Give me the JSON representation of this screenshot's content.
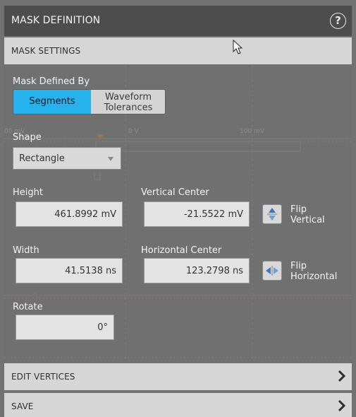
{
  "header": {
    "title": "MASK DEFINITION",
    "help_icon": "?"
  },
  "mask_settings": {
    "section_label": "MASK SETTINGS",
    "mask_defined_by": {
      "label": "Mask Defined By",
      "options": [
        "Segments",
        "Waveform Tolerances"
      ],
      "option_line1": "Waveform",
      "option_line2": "Tolerances",
      "selected": "Segments"
    },
    "shape": {
      "label": "Shape",
      "value": "Rectangle"
    },
    "height": {
      "label": "Height",
      "value": "461.8992 mV"
    },
    "vertical_center": {
      "label": "Vertical Center",
      "value": "-21.5522 mV"
    },
    "flip_vertical": {
      "line1": "Flip",
      "line2": "Vertical"
    },
    "width": {
      "label": "Width",
      "value": "41.5138 ns"
    },
    "horizontal_center": {
      "label": "Horizontal Center",
      "value": "123.2798 ns"
    },
    "flip_horizontal": {
      "line1": "Flip",
      "line2": "Horizontal"
    },
    "rotate": {
      "label": "Rotate",
      "value": "0°"
    }
  },
  "background_waveform": {
    "tick_labels": [
      "00 mV",
      "0 V",
      "100 mV"
    ]
  },
  "edit_vertices": {
    "label": "EDIT VERTICES"
  },
  "save": {
    "label": "SAVE"
  },
  "colors": {
    "accent": "#26b2ec",
    "panel": "#727272",
    "header": "#4d4d4d",
    "section_bar": "#d6d6d6"
  }
}
